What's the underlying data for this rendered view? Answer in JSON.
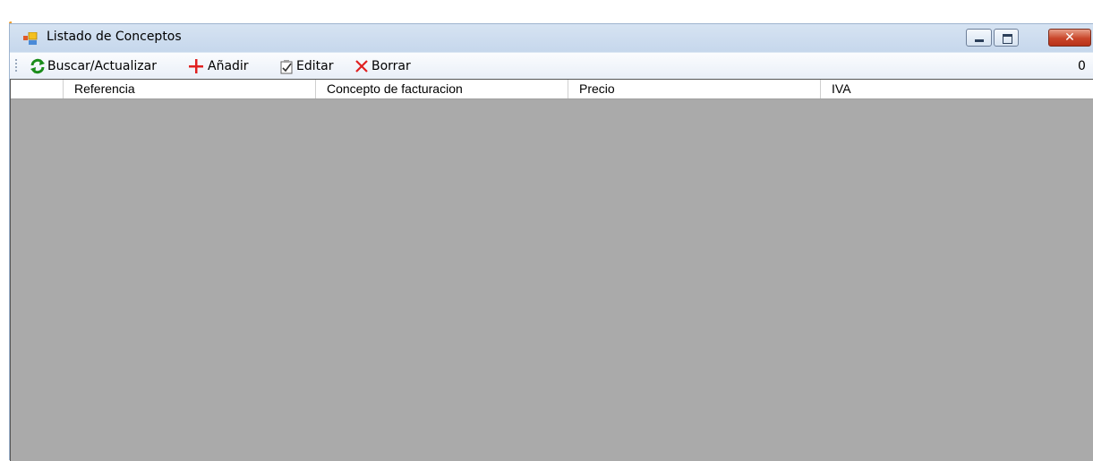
{
  "window": {
    "title": "Listado de Conceptos",
    "icon": "app-window-icon",
    "controls": {
      "minimize_icon": "minimize-icon",
      "maximize_icon": "maximize-icon",
      "close_glyph": "✕"
    }
  },
  "toolbar": {
    "items": [
      {
        "label": "Buscar/Actualizar",
        "icon": "refresh-icon",
        "color": "#1a8c1a"
      },
      {
        "label": "Añadir",
        "icon": "plus-icon",
        "color": "#e02020"
      },
      {
        "label": "Editar",
        "icon": "edit-icon",
        "color": "#404040"
      },
      {
        "label": "Borrar",
        "icon": "delete-x-icon",
        "color": "#e02020"
      }
    ],
    "record_count": "0"
  },
  "grid": {
    "columns": [
      "Referencia",
      "Concepto de facturacion",
      "Precio",
      "IVA"
    ],
    "rows": [],
    "background": "#aaaaaa"
  }
}
